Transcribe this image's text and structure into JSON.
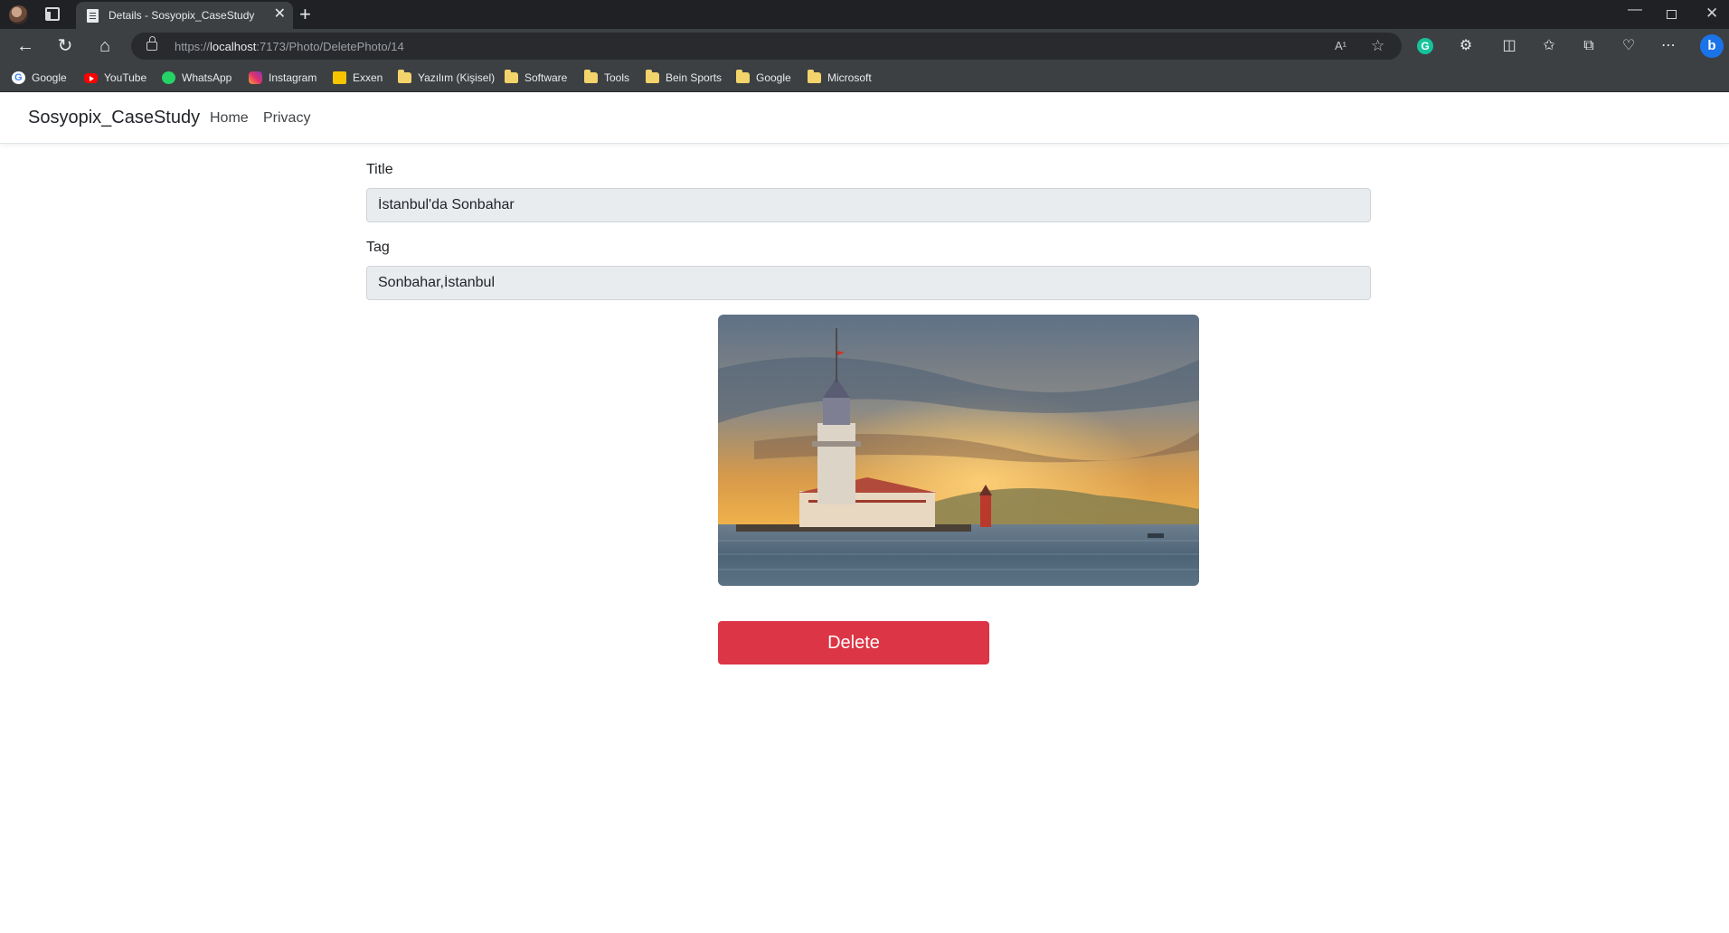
{
  "browser": {
    "tab_title": "Details - Sosyopix_CaseStudy",
    "tab_close": "✕",
    "new_tab": "+",
    "url_scheme": "https://",
    "url_host": "localhost",
    "url_rest": ":7173/Photo/DeletePhoto/14",
    "read_aloud": "A¹",
    "bing_label": "b",
    "grammarly_label": "G",
    "bookmarks": [
      {
        "label": "Google",
        "icon": "google-icon"
      },
      {
        "label": "YouTube",
        "icon": "youtube-icon"
      },
      {
        "label": "WhatsApp",
        "icon": "whatsapp-icon"
      },
      {
        "label": "Instagram",
        "icon": "instagram-icon"
      },
      {
        "label": "Exxen",
        "icon": "exxen-icon"
      },
      {
        "label": "Yazılım (Kişisel)",
        "icon": "folder-icon"
      },
      {
        "label": "Software",
        "icon": "folder-icon"
      },
      {
        "label": "Tools",
        "icon": "folder-icon"
      },
      {
        "label": "Bein Sports",
        "icon": "folder-icon"
      },
      {
        "label": "Google",
        "icon": "folder-icon"
      },
      {
        "label": "Microsoft",
        "icon": "folder-icon"
      }
    ]
  },
  "site": {
    "brand": "Sosyopix_CaseStudy",
    "nav": [
      "Home",
      "Privacy"
    ]
  },
  "form": {
    "title_label": "Title",
    "title_value": "İstanbul'da Sonbahar",
    "tag_label": "Tag",
    "tag_value": "Sonbahar,İstanbul",
    "delete_label": "Delete"
  },
  "colors": {
    "danger": "#dc3545",
    "readonly_input_bg": "#e9ecef",
    "chrome_dark": "#3c4043"
  }
}
